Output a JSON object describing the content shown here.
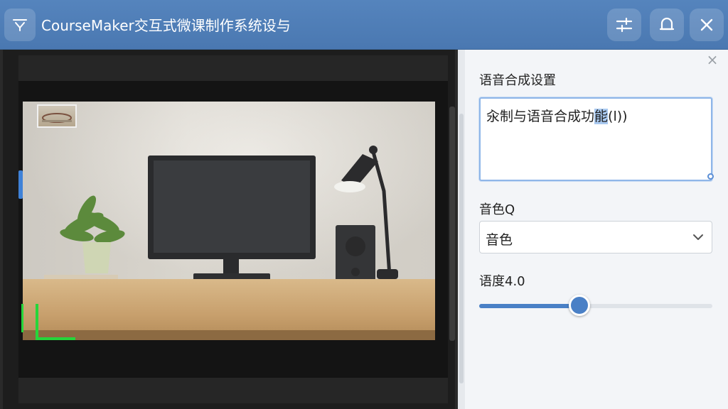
{
  "window": {
    "title": "CourseMaker交互式微课制作系统设与",
    "app_icon": "funnel-icon",
    "buttons": [
      {
        "name": "adjust-button",
        "icon": "sliders-icon"
      },
      {
        "name": "bell-button",
        "icon": "bell-icon"
      },
      {
        "name": "close-button",
        "icon": "close-icon"
      }
    ]
  },
  "preview": {
    "description_icon": "video-preview"
  },
  "panel": {
    "section_title": "语音合成设置",
    "text_value_prefix": "汆制与语音合成功",
    "text_value_selected": "能",
    "text_value_suffix": "(l))",
    "voice_label": "音色Q",
    "voice_selected": "音色",
    "speed_label": "语度4.0",
    "speed_value": 0.43
  },
  "colors": {
    "titlebar": "#4a78b1",
    "accent": "#4a80c6",
    "selection_border": "#26d63a"
  }
}
